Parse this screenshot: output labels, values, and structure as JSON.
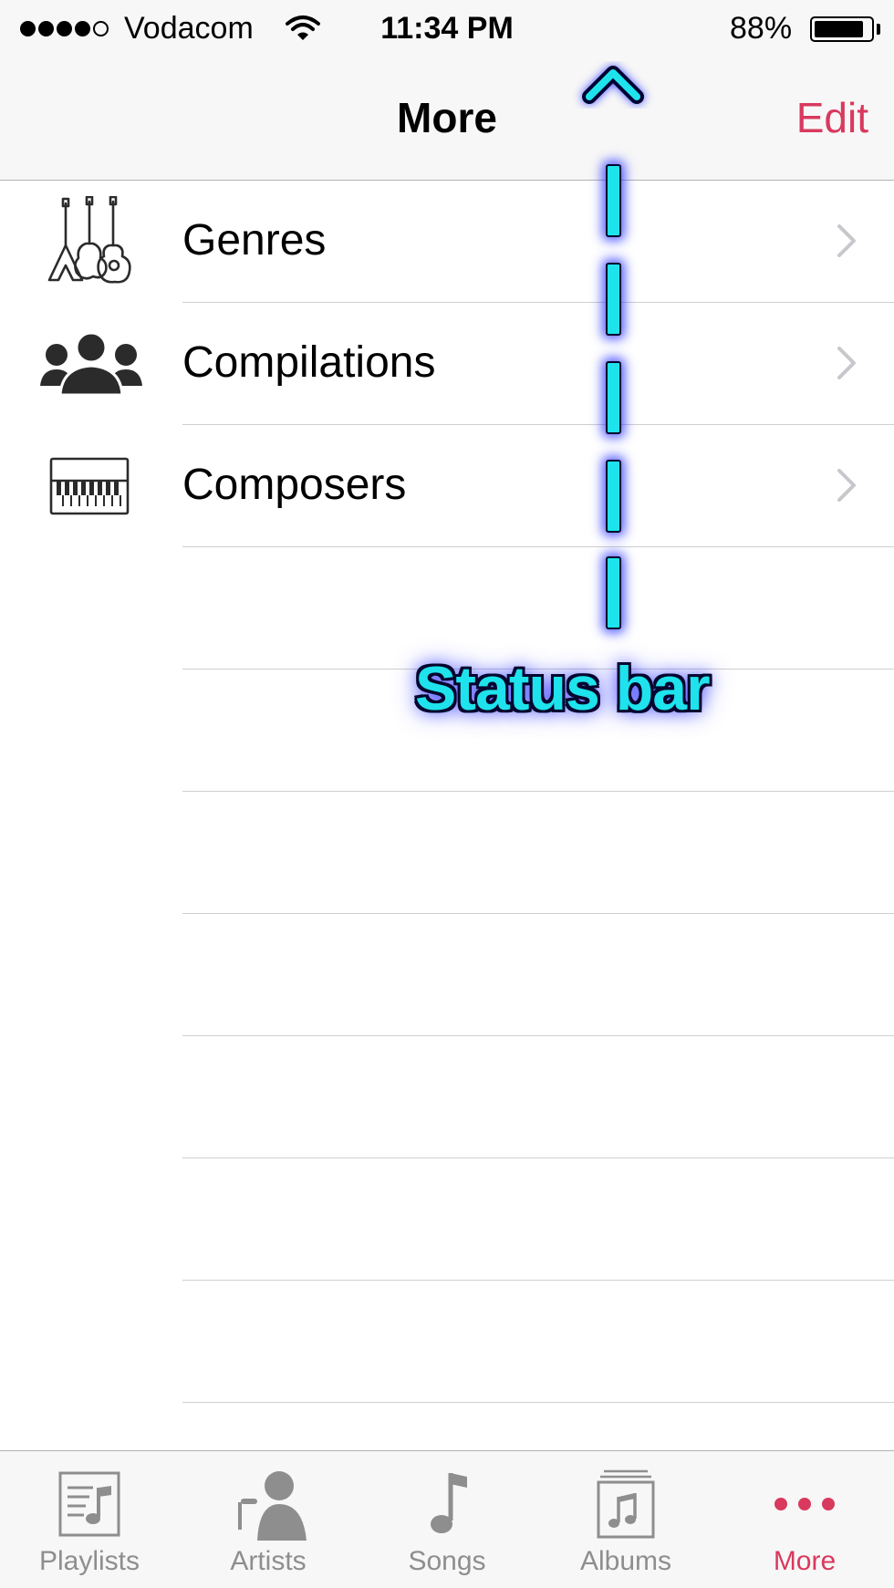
{
  "status_bar": {
    "carrier": "Vodacom",
    "time": "11:34 PM",
    "battery_percent_label": "88%",
    "battery_level": 0.88,
    "signal_bars_filled": 4,
    "signal_bars_total": 5
  },
  "nav": {
    "title": "More",
    "edit_label": "Edit"
  },
  "list": {
    "items": [
      {
        "label": "Genres",
        "icon": "guitars-icon"
      },
      {
        "label": "Compilations",
        "icon": "people-group-icon"
      },
      {
        "label": "Composers",
        "icon": "piano-keyboard-icon"
      }
    ],
    "empty_rows": 7
  },
  "annotation": {
    "label": "Status bar",
    "caret": "^"
  },
  "tab_bar": {
    "tabs": [
      {
        "label": "Playlists",
        "icon": "playlists-icon",
        "active": false
      },
      {
        "label": "Artists",
        "icon": "artist-singer-icon",
        "active": false
      },
      {
        "label": "Songs",
        "icon": "music-note-icon",
        "active": false
      },
      {
        "label": "Albums",
        "icon": "albums-icon",
        "active": false
      },
      {
        "label": "More",
        "icon": "more-dots-icon",
        "active": true
      }
    ]
  },
  "colors": {
    "accent": "#d9395e",
    "annotation_fill": "#1ee3ec",
    "annotation_glow": "#1e28ff"
  }
}
